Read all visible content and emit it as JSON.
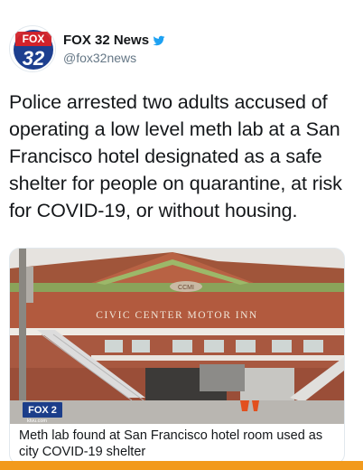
{
  "account": {
    "display_name": "FOX 32 News",
    "handle": "@fox32news",
    "avatar_logo": "FOX 32",
    "verified_icon": "blue-bird-icon"
  },
  "tweet": {
    "text": "Police arrested two adults accused of operating a low level meth lab at a San Francisco hotel designated as a safe shelter for people on quarantine, at risk for COVID-19, or without housing."
  },
  "card": {
    "image_sign": "CIVIC CENTER MOTOR INN",
    "image_logo": "CCMI",
    "watermark": "FOX 2",
    "watermark_url": "ktvu.com",
    "title": "Meth lab found at San Francisco hotel room used as city COVID-19 shelter"
  },
  "colors": {
    "accent_bar": "#f29a1c",
    "fox_red": "#d2232a",
    "fox_blue": "#1d3f8f"
  }
}
